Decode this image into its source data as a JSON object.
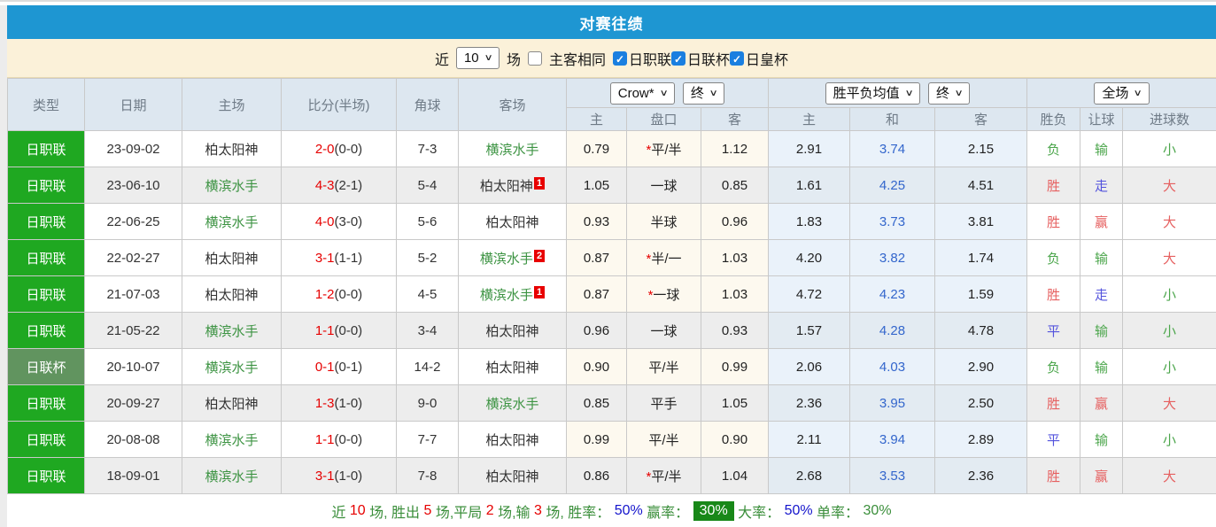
{
  "header": {
    "title": "对赛往绩"
  },
  "filter": {
    "near_label": "近",
    "count_value": "10",
    "games_label": "场",
    "same_side_label": "主客相同",
    "same_side_checked": false,
    "leagues": [
      {
        "label": "日职联",
        "checked": true
      },
      {
        "label": "日联杯",
        "checked": true
      },
      {
        "label": "日皇杯",
        "checked": true
      }
    ]
  },
  "table": {
    "columns": [
      "类型",
      "日期",
      "主场",
      "比分(半场)",
      "角球",
      "客场"
    ],
    "sub_columns": [
      "主",
      "盘口",
      "客",
      "主",
      "和",
      "客",
      "胜负",
      "让球",
      "进球数"
    ],
    "dropdowns": {
      "odds_company": "Crow*",
      "odds_time": "终",
      "avg_label": "胜平负均值",
      "avg_time": "终",
      "scope": "全场"
    },
    "rows": [
      {
        "league": "日职联",
        "league_style": "primary",
        "date": "23-09-02",
        "home": "柏太阳神",
        "home_color": "dark",
        "score": "2-0",
        "half": "(0-0)",
        "corners": "7-3",
        "away": "横滨水手",
        "away_color": "green",
        "away_badge": "",
        "odds_home": "0.79",
        "handicap": "*平/半",
        "odds_away": "1.12",
        "avg_home": "2.91",
        "avg_draw": "3.74",
        "avg_away": "2.15",
        "result": {
          "text": "负",
          "color": "green"
        },
        "handicap_result": {
          "text": "输",
          "color": "green"
        },
        "goals": {
          "text": "小",
          "color": "green"
        }
      },
      {
        "league": "日职联",
        "league_style": "primary",
        "date": "23-06-10",
        "home": "横滨水手",
        "home_color": "green",
        "score": "4-3",
        "half": "(2-1)",
        "corners": "5-4",
        "away": "柏太阳神",
        "away_color": "dark",
        "away_badge": "1",
        "odds_home": "1.05",
        "handicap": "一球",
        "odds_away": "0.85",
        "avg_home": "1.61",
        "avg_draw": "4.25",
        "avg_away": "4.51",
        "result": {
          "text": "胜",
          "color": "red"
        },
        "handicap_result": {
          "text": "走",
          "color": "blue"
        },
        "goals": {
          "text": "大",
          "color": "red"
        }
      },
      {
        "league": "日职联",
        "league_style": "primary",
        "date": "22-06-25",
        "home": "横滨水手",
        "home_color": "green",
        "score": "4-0",
        "half": "(3-0)",
        "corners": "5-6",
        "away": "柏太阳神",
        "away_color": "dark",
        "away_badge": "",
        "odds_home": "0.93",
        "handicap": "半球",
        "odds_away": "0.96",
        "avg_home": "1.83",
        "avg_draw": "3.73",
        "avg_away": "3.81",
        "result": {
          "text": "胜",
          "color": "red"
        },
        "handicap_result": {
          "text": "赢",
          "color": "red"
        },
        "goals": {
          "text": "大",
          "color": "red"
        }
      },
      {
        "league": "日职联",
        "league_style": "primary",
        "date": "22-02-27",
        "home": "柏太阳神",
        "home_color": "dark",
        "score": "3-1",
        "half": "(1-1)",
        "corners": "5-2",
        "away": "横滨水手",
        "away_color": "green",
        "away_badge": "2",
        "odds_home": "0.87",
        "handicap": "*半/一",
        "odds_away": "1.03",
        "avg_home": "4.20",
        "avg_draw": "3.82",
        "avg_away": "1.74",
        "result": {
          "text": "负",
          "color": "green"
        },
        "handicap_result": {
          "text": "输",
          "color": "green"
        },
        "goals": {
          "text": "大",
          "color": "red"
        }
      },
      {
        "league": "日职联",
        "league_style": "primary",
        "date": "21-07-03",
        "home": "柏太阳神",
        "home_color": "dark",
        "score": "1-2",
        "half": "(0-0)",
        "corners": "4-5",
        "away": "横滨水手",
        "away_color": "green",
        "away_badge": "1",
        "odds_home": "0.87",
        "handicap": "*一球",
        "odds_away": "1.03",
        "avg_home": "4.72",
        "avg_draw": "4.23",
        "avg_away": "1.59",
        "result": {
          "text": "胜",
          "color": "red"
        },
        "handicap_result": {
          "text": "走",
          "color": "blue"
        },
        "goals": {
          "text": "小",
          "color": "green"
        }
      },
      {
        "league": "日职联",
        "league_style": "primary",
        "date": "21-05-22",
        "home": "横滨水手",
        "home_color": "green",
        "score": "1-1",
        "half": "(0-0)",
        "corners": "3-4",
        "away": "柏太阳神",
        "away_color": "dark",
        "away_badge": "",
        "odds_home": "0.96",
        "handicap": "一球",
        "odds_away": "0.93",
        "avg_home": "1.57",
        "avg_draw": "4.28",
        "avg_away": "4.78",
        "result": {
          "text": "平",
          "color": "blue"
        },
        "handicap_result": {
          "text": "输",
          "color": "green"
        },
        "goals": {
          "text": "小",
          "color": "green"
        }
      },
      {
        "league": "日联杯",
        "league_style": "muted",
        "date": "20-10-07",
        "home": "横滨水手",
        "home_color": "green",
        "score": "0-1",
        "half": "(0-1)",
        "corners": "14-2",
        "away": "柏太阳神",
        "away_color": "dark",
        "away_badge": "",
        "odds_home": "0.90",
        "handicap": "平/半",
        "odds_away": "0.99",
        "avg_home": "2.06",
        "avg_draw": "4.03",
        "avg_away": "2.90",
        "result": {
          "text": "负",
          "color": "green"
        },
        "handicap_result": {
          "text": "输",
          "color": "green"
        },
        "goals": {
          "text": "小",
          "color": "green"
        }
      },
      {
        "league": "日职联",
        "league_style": "primary",
        "date": "20-09-27",
        "home": "柏太阳神",
        "home_color": "dark",
        "score": "1-3",
        "half": "(1-0)",
        "corners": "9-0",
        "away": "横滨水手",
        "away_color": "green",
        "away_badge": "",
        "odds_home": "0.85",
        "handicap": "平手",
        "odds_away": "1.05",
        "avg_home": "2.36",
        "avg_draw": "3.95",
        "avg_away": "2.50",
        "result": {
          "text": "胜",
          "color": "red"
        },
        "handicap_result": {
          "text": "赢",
          "color": "red"
        },
        "goals": {
          "text": "大",
          "color": "red"
        }
      },
      {
        "league": "日职联",
        "league_style": "primary",
        "date": "20-08-08",
        "home": "横滨水手",
        "home_color": "green",
        "score": "1-1",
        "half": "(0-0)",
        "corners": "7-7",
        "away": "柏太阳神",
        "away_color": "dark",
        "away_badge": "",
        "odds_home": "0.99",
        "handicap": "平/半",
        "odds_away": "0.90",
        "avg_home": "2.11",
        "avg_draw": "3.94",
        "avg_away": "2.89",
        "result": {
          "text": "平",
          "color": "blue"
        },
        "handicap_result": {
          "text": "输",
          "color": "green"
        },
        "goals": {
          "text": "小",
          "color": "green"
        }
      },
      {
        "league": "日职联",
        "league_style": "primary",
        "date": "18-09-01",
        "home": "横滨水手",
        "home_color": "green",
        "score": "3-1",
        "half": "(1-0)",
        "corners": "7-8",
        "away": "柏太阳神",
        "away_color": "dark",
        "away_badge": "",
        "odds_home": "0.86",
        "handicap": "*平/半",
        "odds_away": "1.04",
        "avg_home": "2.68",
        "avg_draw": "3.53",
        "avg_away": "2.36",
        "result": {
          "text": "胜",
          "color": "red"
        },
        "handicap_result": {
          "text": "赢",
          "color": "red"
        },
        "goals": {
          "text": "大",
          "color": "red"
        }
      }
    ]
  },
  "summary": {
    "segments": [
      {
        "text": "近 ",
        "style": "green"
      },
      {
        "text": "10",
        "style": "red"
      },
      {
        "text": " 场, 胜出 ",
        "style": "green"
      },
      {
        "text": "5",
        "style": "red"
      },
      {
        "text": " 场,平局 ",
        "style": "green"
      },
      {
        "text": "2",
        "style": "red"
      },
      {
        "text": " 场,输 ",
        "style": "green"
      },
      {
        "text": "3",
        "style": "red"
      },
      {
        "text": " 场, 胜率： ",
        "style": "green"
      },
      {
        "text": "50%",
        "style": "blue"
      },
      {
        "text": " 赢率： ",
        "style": "green"
      },
      {
        "text": "30%",
        "style": "green-badge"
      },
      {
        "text": " 大率： ",
        "style": "green"
      },
      {
        "text": "50%",
        "style": "blue"
      },
      {
        "text": " 单率： ",
        "style": "green"
      },
      {
        "text": "30%",
        "style": "green"
      }
    ]
  },
  "colors": {
    "title_bar": "#1e96d2",
    "filter_bg": "#fbf1d9",
    "header_bg": "#dde7f0",
    "league_badge_green": "#1fa821",
    "league_badge_muted": "#61945f",
    "team_link_green": "#3c9342",
    "score_red": "#e60000",
    "avg_draw_blue": "#3366cc",
    "win_red": "#e66060",
    "lose_green": "#4ca64c",
    "draw_blue": "#5353dd",
    "checkbox_blue": "#1a7fe0",
    "summary_badge_green": "#188818"
  }
}
